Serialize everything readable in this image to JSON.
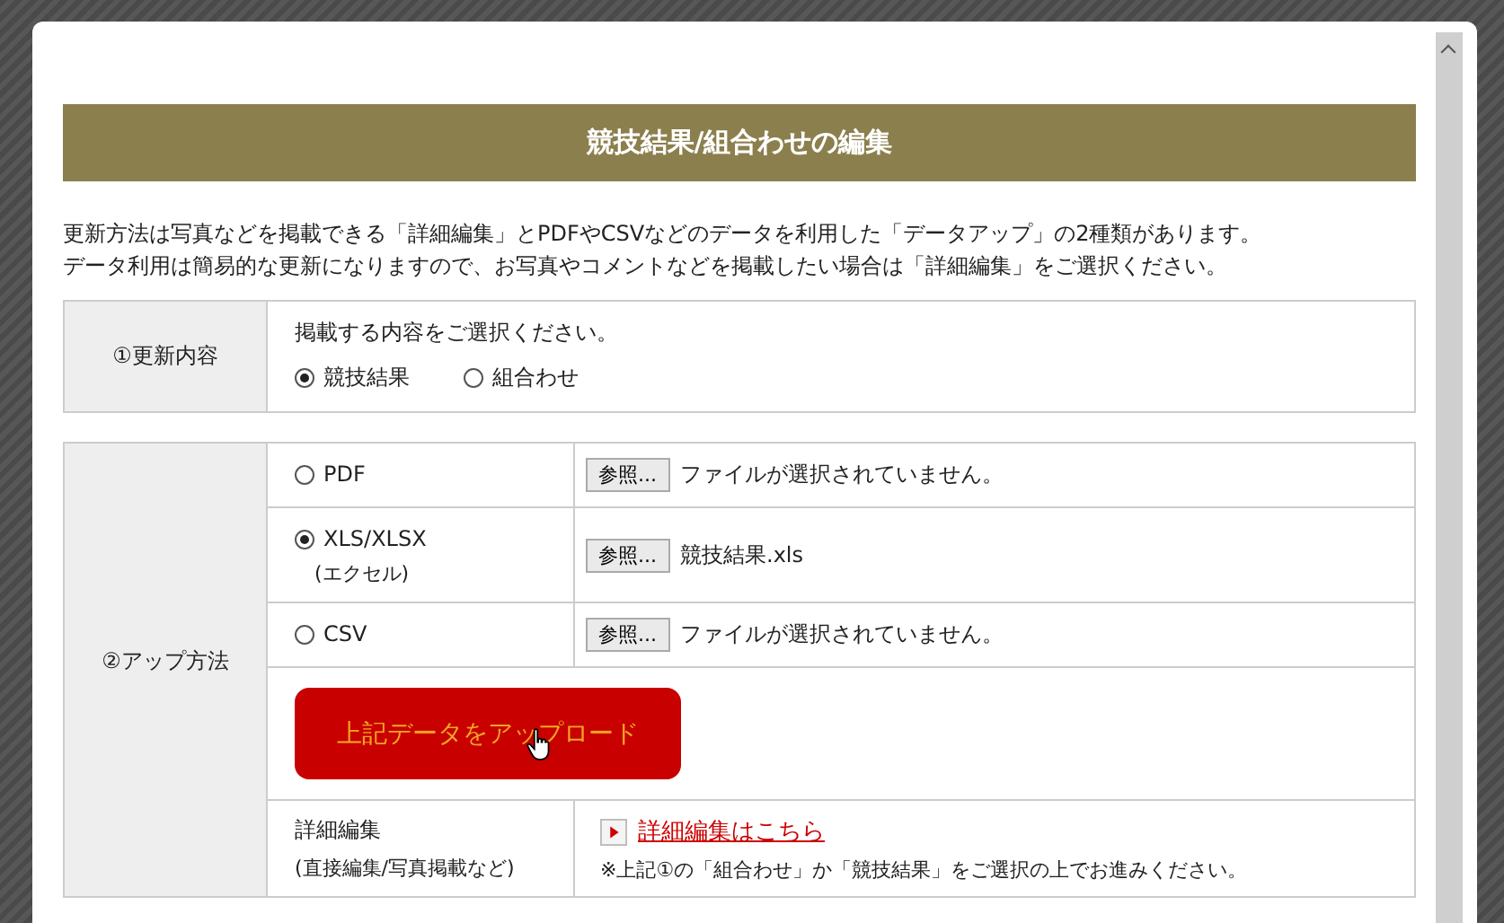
{
  "dialog": {
    "title": "競技結果/組合わせの編集",
    "intro": [
      "更新方法は写真などを掲載できる「詳細編集」とPDFやCSVなどのデータを利用した「データアップ」の2種類があります。",
      "データ利用は簡易的な更新になりますので、お写真やコメントなどを掲載したい場合は「詳細編集」をご選択ください。"
    ],
    "content_section": {
      "label": "①更新内容",
      "prompt": "掲載する内容をご選択ください。",
      "options": [
        {
          "label": "競技結果",
          "selected": true
        },
        {
          "label": "組合わせ",
          "selected": false
        }
      ]
    },
    "upload_section": {
      "label": "②アップ方法",
      "formats": [
        {
          "label": "PDF",
          "selected": false,
          "browse_button": "参照...",
          "file": "ファイルが選択されていません。"
        },
        {
          "label": "XLS/XLSX",
          "sublabel": "(エクセル)",
          "selected": true,
          "browse_button": "参照...",
          "file": "競技結果.xls"
        },
        {
          "label": "CSV",
          "selected": false,
          "browse_button": "参照...",
          "file": "ファイルが選択されていません。"
        }
      ],
      "upload_button": "上記データをアップロード",
      "detail": {
        "label": "詳細編集",
        "sublabel": "(直接編集/写真掲載など)",
        "link": "詳細編集はこちら",
        "note": "※上記①の「組合わせ」か「競技結果」をご選択の上でお進みください。"
      }
    }
  }
}
